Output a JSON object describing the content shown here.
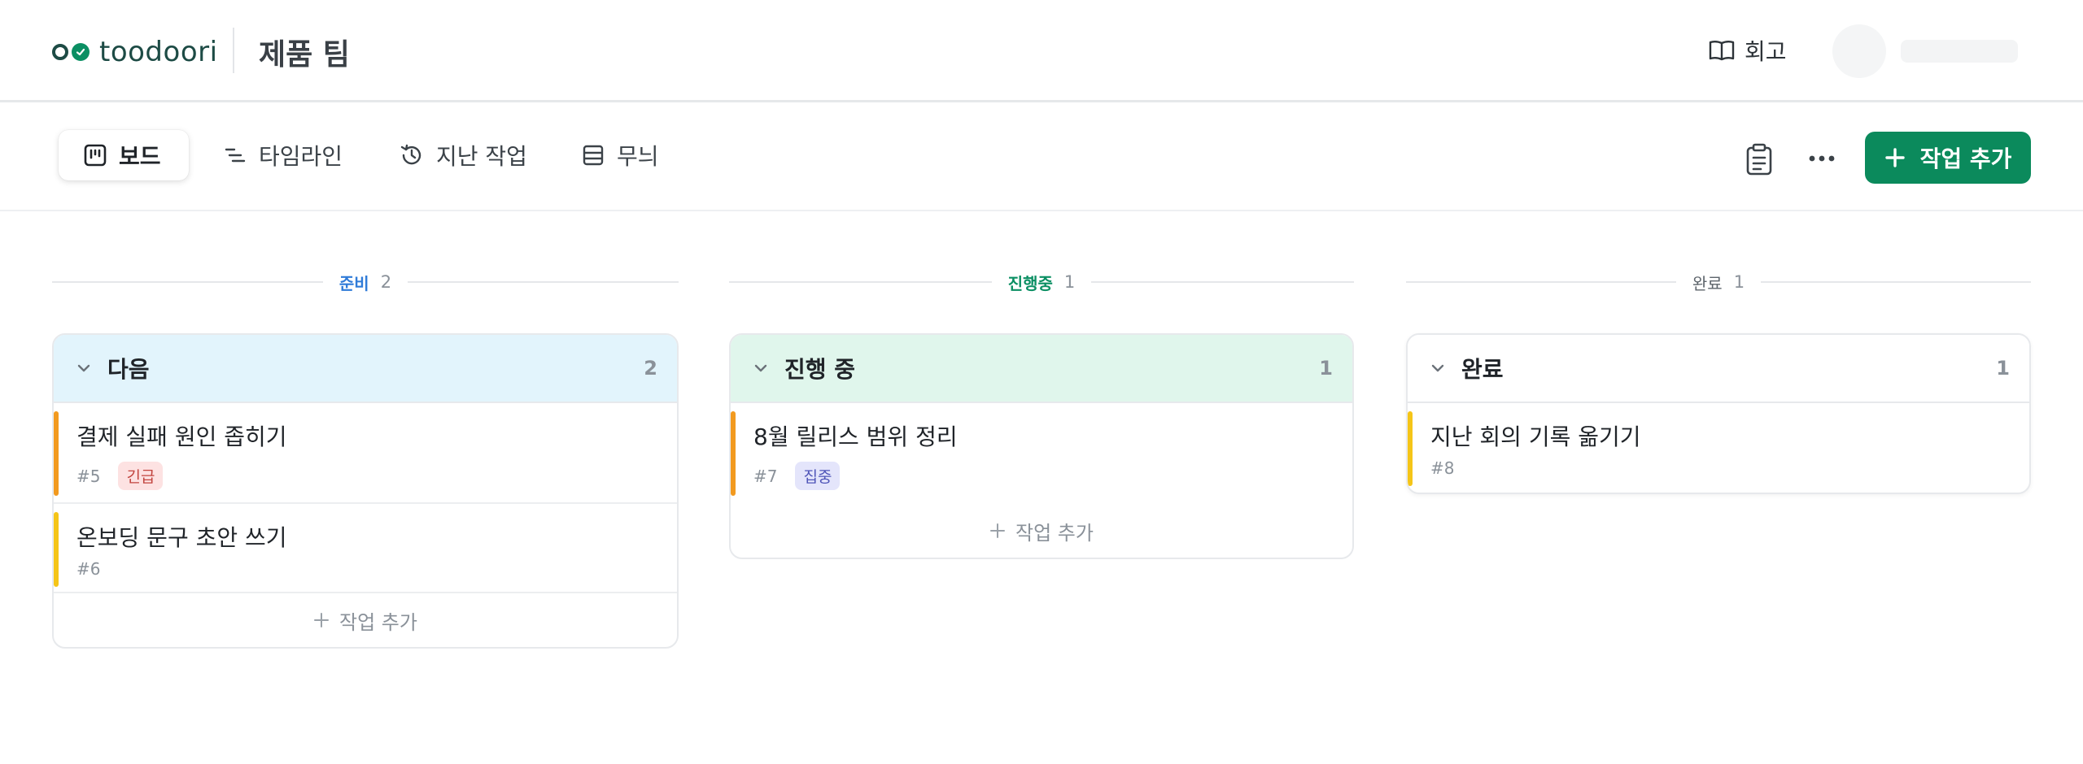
{
  "header": {
    "logo_text": "toodoori",
    "team_name": "제품 팀",
    "retro_label": "회고"
  },
  "toolbar": {
    "tabs": [
      {
        "label": "보드",
        "icon": "board-icon"
      },
      {
        "label": "타임라인",
        "icon": "timeline-icon"
      },
      {
        "label": "지난 작업",
        "icon": "history-icon"
      },
      {
        "label": "무늬",
        "icon": "list-icon"
      }
    ],
    "add_task_label": "작업 추가"
  },
  "colors": {
    "brand": "#0b8a5c",
    "ready": "#2f7bd8",
    "in_progress": "#0b8f63",
    "done": "#5d646b",
    "urgent_bar": "#f29a1f",
    "normal_bar": "#f5c518"
  },
  "columns": [
    {
      "status": "준비",
      "status_count": "2",
      "group_title": "다음",
      "group_count": "2",
      "tasks": [
        {
          "title": "결제 실패 원인 좁히기",
          "id": "#5",
          "tag": "긴급"
        },
        {
          "title": "온보딩 문구 초안 쓰기",
          "id": "#6",
          "tag": ""
        }
      ],
      "add_label": "작업 추가"
    },
    {
      "status": "진행중",
      "status_count": "1",
      "group_title": "진행 중",
      "group_count": "1",
      "tasks": [
        {
          "title": "8월 릴리스 범위 정리",
          "id": "#7",
          "tag": "집중"
        }
      ],
      "add_label": "작업 추가"
    },
    {
      "status": "완료",
      "status_count": "1",
      "group_title": "완료",
      "group_count": "1",
      "tasks": [
        {
          "title": "지난 회의 기록 옮기기",
          "id": "#8",
          "tag": ""
        }
      ]
    }
  ]
}
